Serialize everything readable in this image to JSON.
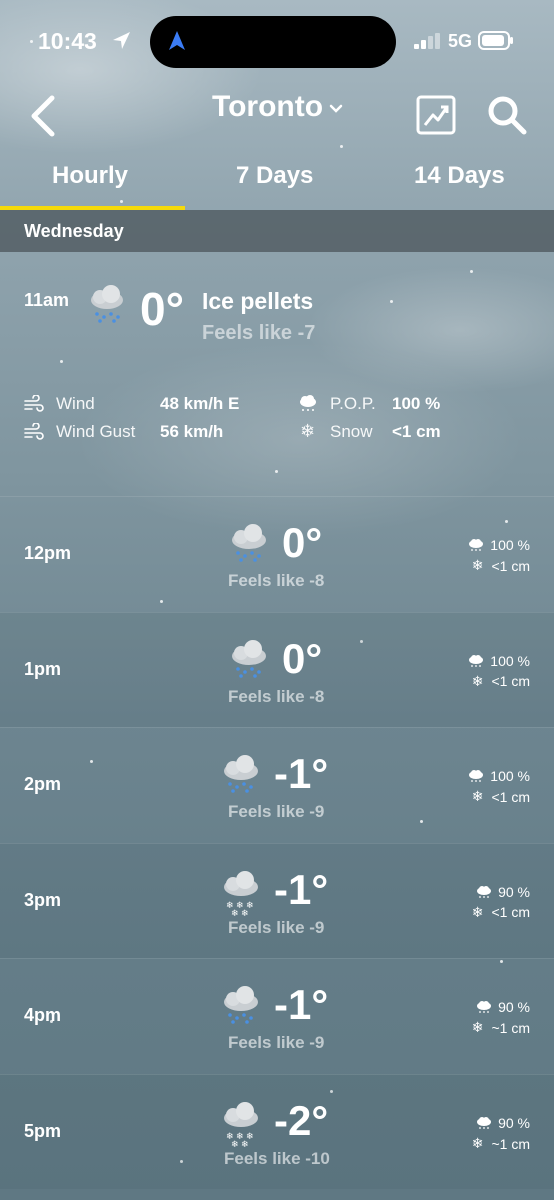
{
  "status": {
    "time": "10:43",
    "network": "5G"
  },
  "header": {
    "city": "Toronto"
  },
  "tabs": [
    "Hourly",
    "7 Days",
    "14 Days"
  ],
  "day": "Wednesday",
  "current": {
    "time": "11am",
    "temp": "0°",
    "condition": "Ice pellets",
    "feels": "Feels like -7",
    "wind_label": "Wind",
    "wind_value": "48 km/h E",
    "gust_label": "Wind Gust",
    "gust_value": "56 km/h",
    "pop_label": "P.O.P.",
    "pop_value": "100 %",
    "snow_label": "Snow",
    "snow_value": "<1 cm"
  },
  "hours": [
    {
      "time": "12pm",
      "temp": "0°",
      "feels": "Feels like -8",
      "pop": "100 %",
      "snow": "<1 cm",
      "icon": "ice-pellets-icon"
    },
    {
      "time": "1pm",
      "temp": "0°",
      "feels": "Feels like -8",
      "pop": "100 %",
      "snow": "<1 cm",
      "icon": "ice-pellets-icon"
    },
    {
      "time": "2pm",
      "temp": "-1°",
      "feels": "Feels like -9",
      "pop": "100 %",
      "snow": "<1 cm",
      "icon": "ice-pellets-icon"
    },
    {
      "time": "3pm",
      "temp": "-1°",
      "feels": "Feels like -9",
      "pop": "90 %",
      "snow": "<1 cm",
      "icon": "snow-icon"
    },
    {
      "time": "4pm",
      "temp": "-1°",
      "feels": "Feels like -9",
      "pop": "90 %",
      "snow": "~1 cm",
      "icon": "ice-pellets-icon"
    },
    {
      "time": "5pm",
      "temp": "-2°",
      "feels": "Feels like -10",
      "pop": "90 %",
      "snow": "~1 cm",
      "icon": "snow-icon"
    }
  ],
  "colors": {
    "tab_accent": "#f5d90a",
    "pellet_blue": "#4a90e2"
  }
}
